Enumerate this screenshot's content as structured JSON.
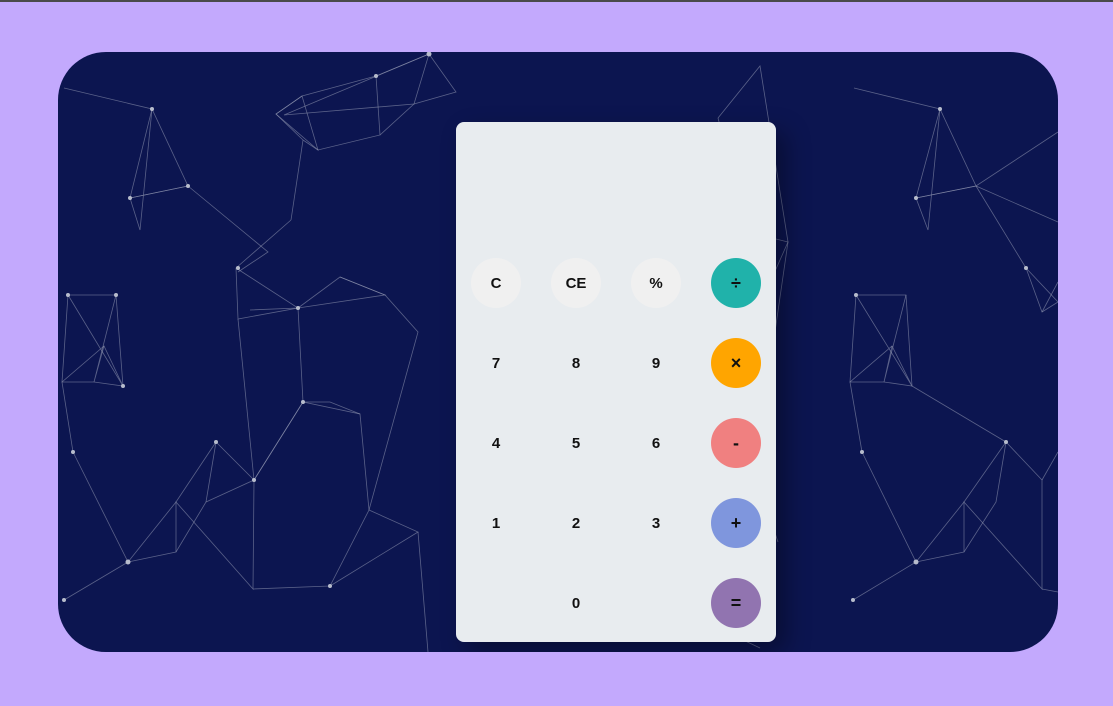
{
  "calculator": {
    "display_value": "",
    "keys": {
      "clear": "C",
      "clear_entry": "CE",
      "percent": "%",
      "divide": "÷",
      "seven": "7",
      "eight": "8",
      "nine": "9",
      "multiply": "×",
      "four": "4",
      "five": "5",
      "six": "6",
      "subtract": "-",
      "one": "1",
      "two": "2",
      "three": "3",
      "add": "+",
      "zero": "0",
      "equals": "="
    }
  },
  "colors": {
    "page_background": "#c3a9fd",
    "stage_background": "#0c1550",
    "calculator_body": "#e8ecef",
    "function_key": "#f0f0f0",
    "divide": "#20b2aa",
    "multiply": "#ffa500",
    "subtract": "#f08080",
    "add": "#7f96dd",
    "equals": "#9174b0"
  }
}
